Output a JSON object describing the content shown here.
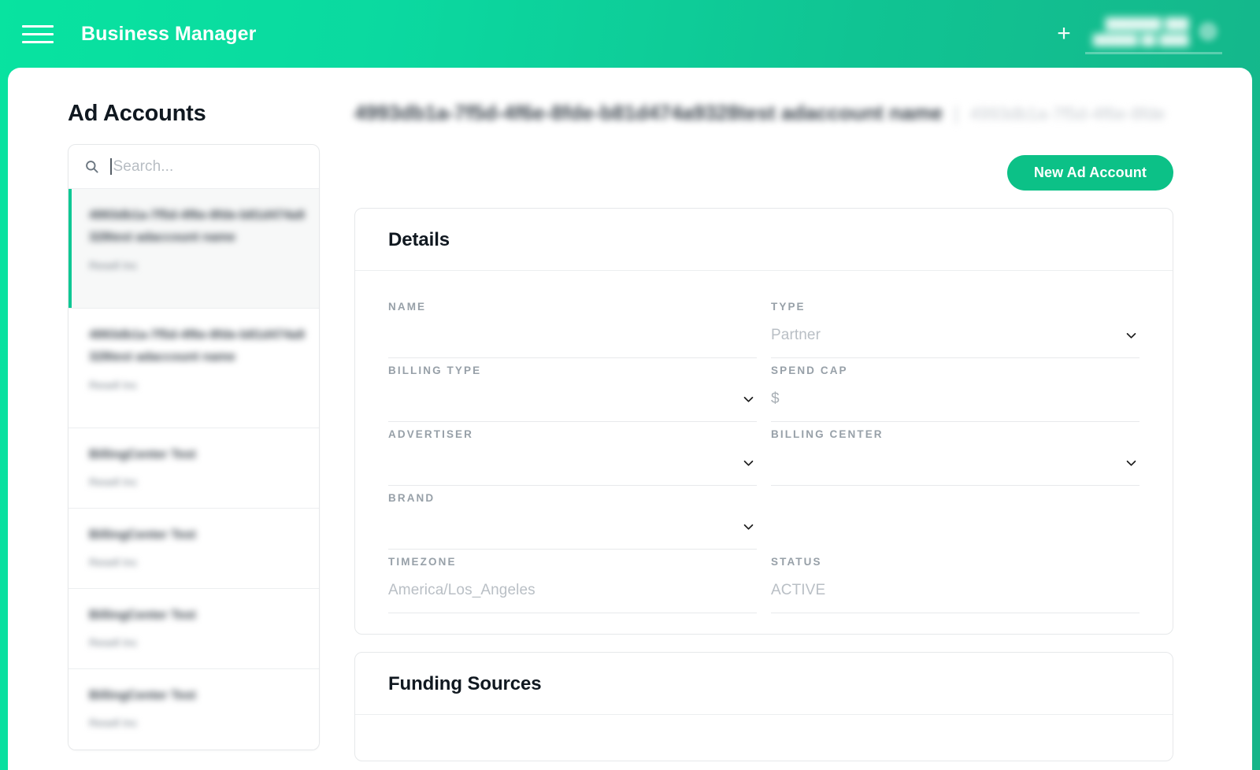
{
  "topbar": {
    "menu_icon": "hamburger-icon",
    "brand": "Business Manager",
    "add_icon": "plus-icon",
    "account": {
      "line1": "███████ ███",
      "line2": "██████ ██ ████"
    },
    "avatar_icon": "avatar-icon"
  },
  "sidebar": {
    "title": "Ad Accounts",
    "search": {
      "icon": "search-icon",
      "placeholder": "Search...",
      "value": ""
    },
    "accounts": [
      {
        "name": "4993db1a-7f5d-4f6e-8fde-b81d474a9328test adaccount name",
        "sub": "Resell Inc",
        "selected": true
      },
      {
        "name": "4993db1a-7f5d-4f6e-8fde-b81d474a9328test adaccount name",
        "sub": "Resell Inc",
        "selected": false
      },
      {
        "name": "BillingCenter Test",
        "sub": "Resell Inc",
        "selected": false
      },
      {
        "name": "BillingCenter Test",
        "sub": "Resell Inc",
        "selected": false
      },
      {
        "name": "BillingCenter Test",
        "sub": "Resell Inc",
        "selected": false
      },
      {
        "name": "BillingCenter Test",
        "sub": "Resell Inc",
        "selected": false
      }
    ]
  },
  "main": {
    "page_title": "4993db1a-7f5d-4f6e-8fde-b81d474a9328test adaccount name",
    "title_separator": "|",
    "page_subtitle": "4993db1a-7f5d-4f6e-8fde",
    "new_ad_account_label": "New Ad Account",
    "details": {
      "title": "Details",
      "fields": [
        {
          "label": "NAME",
          "value": "",
          "placeholder": "",
          "control": "text",
          "prefix": ""
        },
        {
          "label": "TYPE",
          "value": "Partner",
          "placeholder": "",
          "control": "select",
          "prefix": ""
        },
        {
          "label": "BILLING TYPE",
          "value": "",
          "placeholder": "",
          "control": "select",
          "prefix": ""
        },
        {
          "label": "SPEND CAP",
          "value": "",
          "placeholder": "",
          "control": "text",
          "prefix": "$"
        },
        {
          "label": "ADVERTISER",
          "value": "",
          "placeholder": "",
          "control": "select",
          "prefix": ""
        },
        {
          "label": "BILLING CENTER",
          "value": "",
          "placeholder": "",
          "control": "select",
          "prefix": ""
        },
        {
          "label": "BRAND",
          "value": "",
          "placeholder": "",
          "control": "select",
          "prefix": ""
        },
        {
          "label": "",
          "value": "",
          "placeholder": "",
          "control": "none",
          "prefix": ""
        },
        {
          "label": "TIMEZONE",
          "value": "America/Los_Angeles",
          "placeholder": "",
          "control": "text",
          "prefix": ""
        },
        {
          "label": "STATUS",
          "value": "ACTIVE",
          "placeholder": "",
          "control": "text",
          "prefix": ""
        }
      ]
    },
    "funding_sources": {
      "title": "Funding Sources"
    }
  },
  "colors": {
    "header_gradient_start": "#08e3a0",
    "header_gradient_end": "#16b489",
    "accent_green": "#0cc187",
    "selected_bar": "#0ec894",
    "label_gray": "#97a0a8",
    "value_gray": "#b9bfc5",
    "title_dark": "#101820"
  }
}
